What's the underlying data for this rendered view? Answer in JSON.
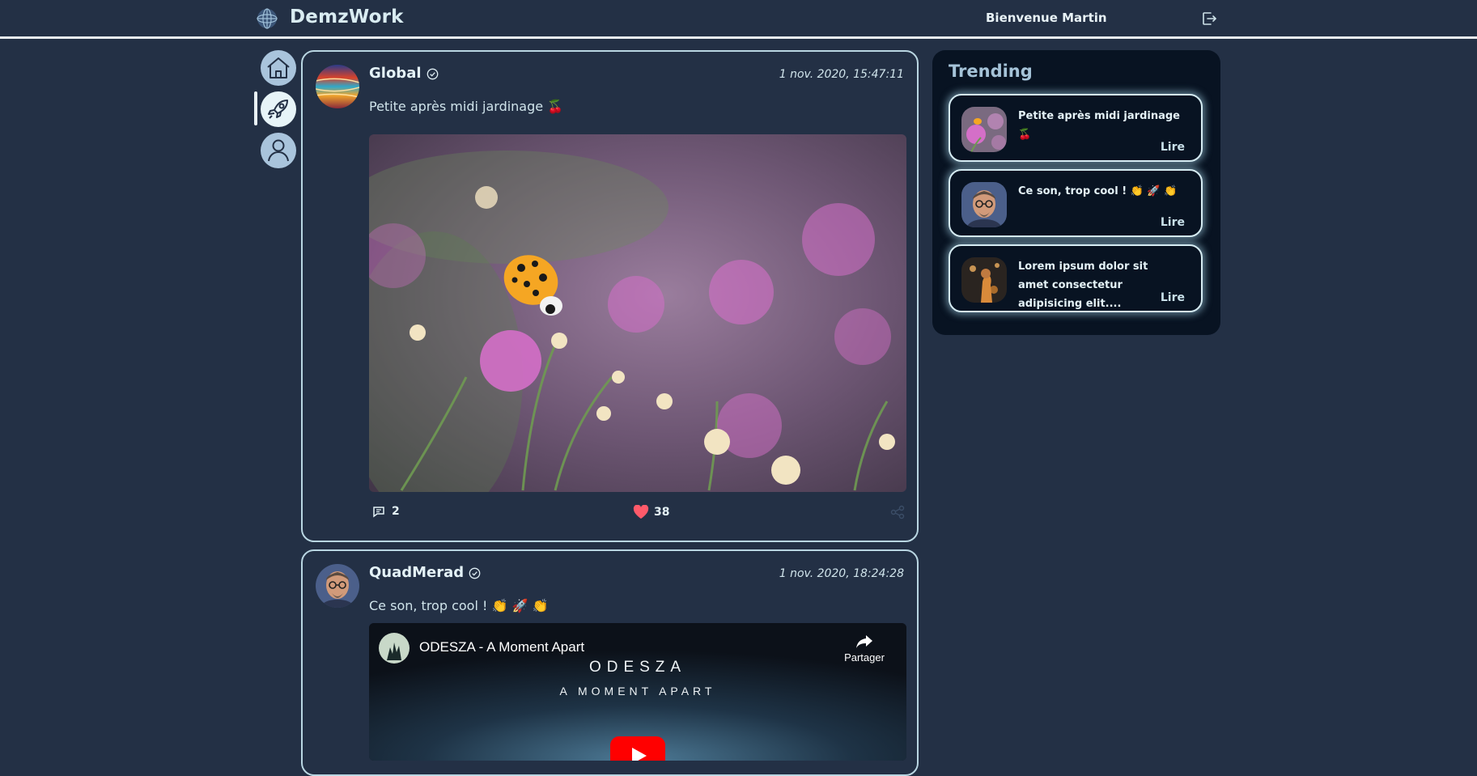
{
  "header": {
    "brand": "DemzWork",
    "welcome": "Bienvenue Martin"
  },
  "nav": [
    {
      "name": "home"
    },
    {
      "name": "explore",
      "active": true
    },
    {
      "name": "profile"
    }
  ],
  "posts": [
    {
      "author": "Global",
      "date": "1 nov. 2020, 15:47:11",
      "text": "Petite après midi jardinage 🍒",
      "comments": "2",
      "likes": "38"
    },
    {
      "author": "QuadMerad",
      "date": "1 nov. 2020, 18:24:28",
      "text": "Ce son, trop cool ! 👏 🚀 👏",
      "video": {
        "title": "ODESZA - A Moment Apart",
        "share_label": "Partager",
        "art_line1": "ODESZA",
        "art_line2": "A MOMENT APART"
      }
    }
  ],
  "trending": {
    "title": "Trending",
    "items": [
      {
        "text": "Petite après midi jardinage 🍒",
        "read": "Lire"
      },
      {
        "text": "Ce son, trop cool ! 👏 🚀 👏",
        "read": "Lire"
      },
      {
        "text": "Lorem ipsum dolor sit amet consectetur adipisicing elit....",
        "read": "Lire"
      }
    ]
  },
  "colors": {
    "background": "#233045",
    "panel": "#081322",
    "accent": "#e7f4f8",
    "like": "#ff5a6a"
  }
}
